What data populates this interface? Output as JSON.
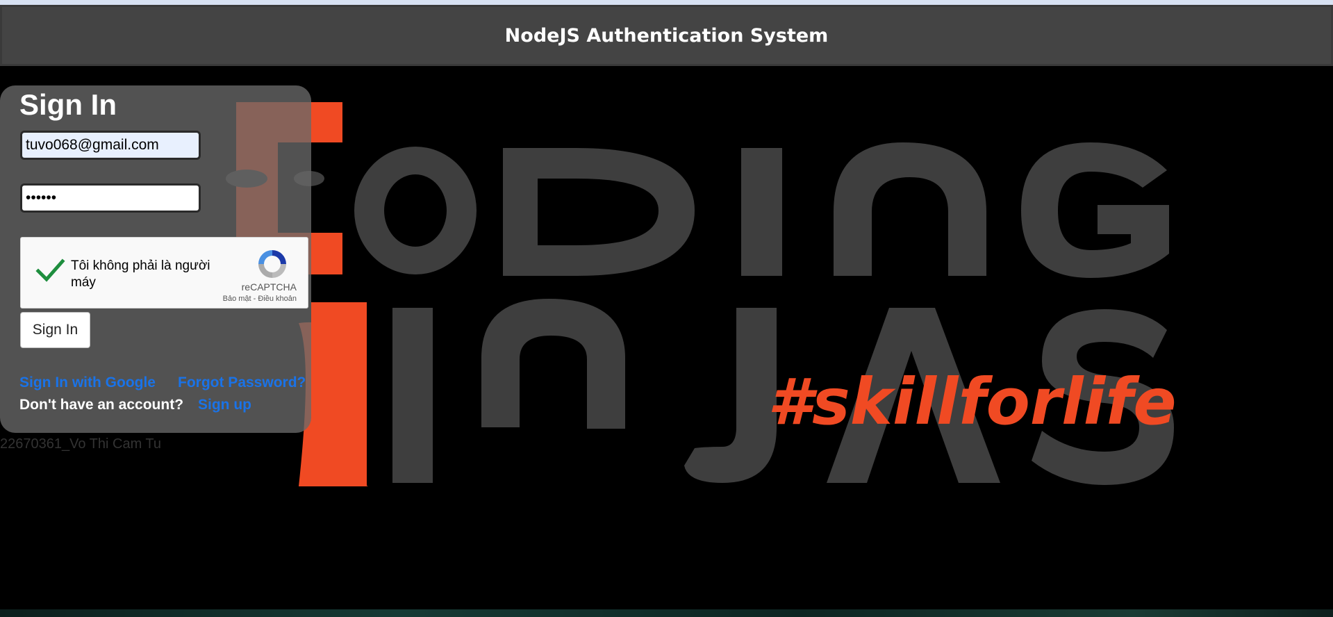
{
  "header": {
    "title": "NodeJS Authentication System"
  },
  "background": {
    "tagline": "#skillforlife",
    "logo_text_alt": "CODING NINJAS"
  },
  "signin": {
    "title": "Sign In",
    "email_value": "tuvo068@gmail.com",
    "password_value": "••••••",
    "button_label": "Sign In",
    "google_link": "Sign In with Google",
    "forgot_link": "Forgot Password?",
    "no_account_text": "Don't have an account?",
    "signup_link": "Sign up"
  },
  "captcha": {
    "label": "Tôi không phải là người máy",
    "brand": "reCAPTCHA",
    "links": "Bảo mật - Điều khoản",
    "checked": true
  },
  "footer": {
    "student_id": "22670361_Vo Thi Cam Tu"
  },
  "colors": {
    "header_bg": "#444444",
    "accent_orange": "#f04a23",
    "link_blue": "#1a73e8",
    "logo_gray": "#3e3e3e",
    "check_green": "#1e8e3e"
  }
}
